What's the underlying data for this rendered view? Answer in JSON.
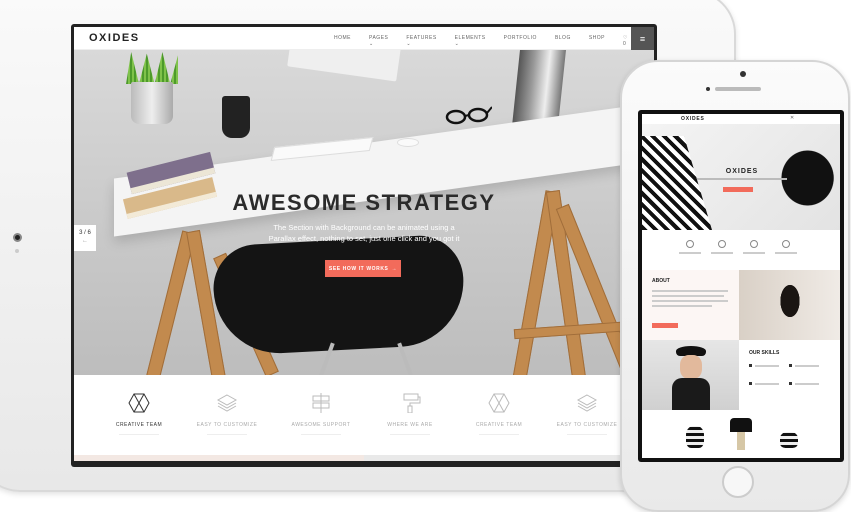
{
  "tablet": {
    "nav": {
      "logo": "OXIDES",
      "items": [
        "HOME",
        "PAGES ⌄",
        "FEATURES ⌄",
        "ELEMENTS ⌄",
        "PORTFOLIO",
        "BLOG",
        "SHOP"
      ],
      "wishlist_count": "0",
      "cart_count": "0"
    },
    "hero": {
      "title": "AWESOME STRATEGY",
      "subtitle": "The Section with Background can be animated using a Parallax effect, nothing to set, just one click and you got it",
      "button_label": "SEE HOW IT WORKS",
      "slide_indicator": "3 / 6"
    },
    "features": [
      {
        "label": "CREATIVE TEAM",
        "icon": "hexagon-x-icon",
        "active": true
      },
      {
        "label": "EASY TO CUSTOMIZE",
        "icon": "layers-icon",
        "active": false
      },
      {
        "label": "AWESOME SUPPORT",
        "icon": "signpost-icon",
        "active": false
      },
      {
        "label": "WHERE WE ARE",
        "icon": "paint-roller-icon",
        "active": false
      },
      {
        "label": "CREATIVE TEAM",
        "icon": "hexagon-x-icon",
        "active": false
      },
      {
        "label": "EASY TO CUSTOMIZE",
        "icon": "layers-icon",
        "active": false
      }
    ]
  },
  "phone": {
    "logo": "OXIDES",
    "hero_title": "OXIDES",
    "about_title": "ABOUT",
    "skills_title": "OUR SKILLS"
  },
  "colors": {
    "accent": "#f26b5b",
    "device_frame": "#f2f2f2",
    "dark": "#222222"
  }
}
